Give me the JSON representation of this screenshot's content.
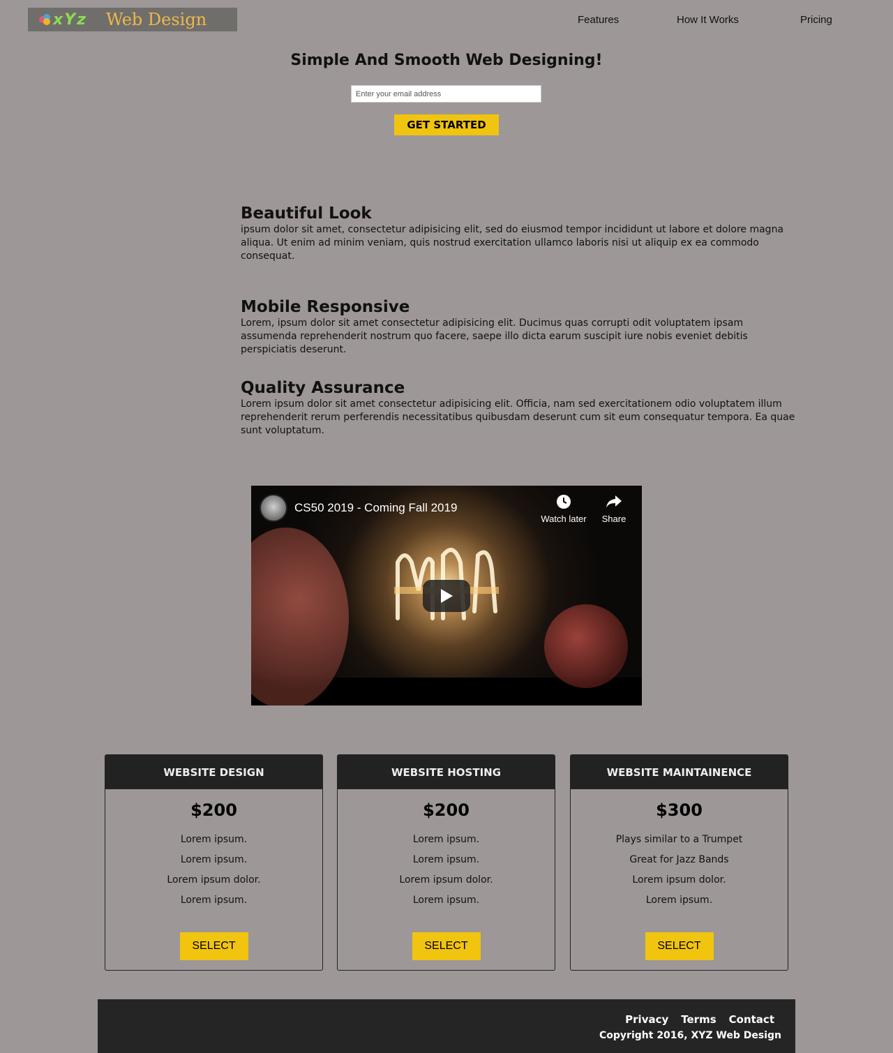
{
  "header": {
    "logo_mark": "xYz",
    "logo_text": "Web Design",
    "nav": [
      "Features",
      "How It Works",
      "Pricing"
    ]
  },
  "hero": {
    "title": "Simple And Smooth Web Designing!",
    "email_placeholder": "Enter your email address",
    "cta": "GET STARTED"
  },
  "features": [
    {
      "title": "Beautiful Look",
      "text": "ipsum dolor sit amet, consectetur adipisicing elit, sed do eiusmod tempor incididunt ut labore et dolore magna aliqua. Ut enim ad minim veniam, quis nostrud exercitation ullamco laboris nisi ut aliquip ex ea commodo consequat."
    },
    {
      "title": "Mobile Responsive",
      "text": "Lorem, ipsum dolor sit amet consectetur adipisicing elit. Ducimus quas corrupti odit voluptatem ipsam assumenda reprehenderit nostrum quo facere, saepe illo dicta earum suscipit iure nobis eveniet debitis perspiciatis deserunt."
    },
    {
      "title": "Quality Assurance",
      "text": "Lorem ipsum dolor sit amet consectetur adipisicing elit. Officia, nam sed exercitationem odio voluptatem illum reprehenderit rerum perferendis necessitatibus quibusdam deserunt cum sit eum consequatur tempora. Ea quae sunt voluptatum."
    }
  ],
  "video": {
    "title": "CS50 2019 - Coming Fall 2019",
    "watch_later": "Watch later",
    "share": "Share"
  },
  "pricing": [
    {
      "name": "WEBSITE DESIGN",
      "price": "$200",
      "items": [
        "Lorem ipsum.",
        "Lorem ipsum.",
        "Lorem ipsum dolor.",
        "Lorem ipsum."
      ],
      "button": "SELECT"
    },
    {
      "name": "WEBSITE HOSTING",
      "price": "$200",
      "items": [
        "Lorem ipsum.",
        "Lorem ipsum.",
        "Lorem ipsum dolor.",
        "Lorem ipsum."
      ],
      "button": "SELECT"
    },
    {
      "name": "WEBSITE MAINTAINENCE",
      "price": "$300",
      "items": [
        "Plays similar to a Trumpet",
        "Great for Jazz Bands",
        "Lorem ipsum dolor.",
        "Lorem ipsum."
      ],
      "button": "SELECT"
    }
  ],
  "footer": {
    "links": [
      "Privacy",
      "Terms",
      "Contact"
    ],
    "copyright": "Copyright 2016, XYZ Web Design"
  },
  "colors": {
    "background": "#9d9797",
    "accent": "#f1c40f",
    "dark": "#232222"
  }
}
